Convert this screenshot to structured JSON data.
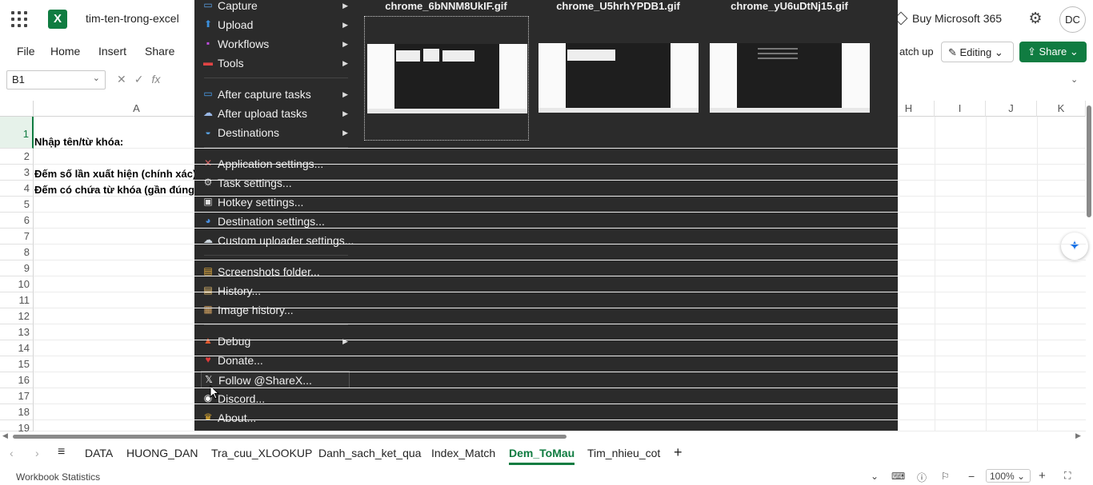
{
  "titlebar": {
    "doc_title": "tim-ten-trong-excel",
    "buy_label": "Buy Microsoft 365",
    "avatar_initials": "DC"
  },
  "ribbon": {
    "tabs": [
      "File",
      "Home",
      "Insert",
      "Share"
    ],
    "catchup_label": "atch up",
    "editing_label": "Editing",
    "share_label": "Share"
  },
  "formula_bar": {
    "name_box": "B1",
    "fx": "fx"
  },
  "grid": {
    "columns": [
      "A",
      "H",
      "I",
      "J",
      "K"
    ],
    "rows": [
      "1",
      "2",
      "3",
      "4",
      "5",
      "6",
      "7",
      "8",
      "9",
      "10",
      "11",
      "12",
      "13",
      "14",
      "15",
      "16",
      "17",
      "18",
      "19"
    ],
    "cells": {
      "A1": "Nhập tên/từ khóa:",
      "A3": "Đếm số lần xuất hiện (chính xác):",
      "A4": "Đếm có chứa từ khóa (gần đúng):"
    }
  },
  "sheet_tabs": [
    "DATA",
    "HUONG_DAN",
    "Tra_cuu_XLOOKUP",
    "Danh_sach_ket_qua",
    "Index_Match",
    "Dem_ToMau",
    "Tim_nhieu_cot"
  ],
  "active_sheet": "Dem_ToMau",
  "status": {
    "left": "Workbook Statistics",
    "zoom": "100%"
  },
  "sharex_menu": {
    "items": [
      {
        "label": "Capture",
        "icon": "capture-icon",
        "submenu": true
      },
      {
        "label": "Upload",
        "icon": "upload-icon",
        "submenu": true
      },
      {
        "label": "Workflows",
        "icon": "workflows-icon",
        "submenu": true
      },
      {
        "label": "Tools",
        "icon": "tools-icon",
        "submenu": true
      },
      {
        "label": "After capture tasks",
        "icon": "after-capture-icon",
        "submenu": true
      },
      {
        "label": "After upload tasks",
        "icon": "after-upload-icon",
        "submenu": true
      },
      {
        "label": "Destinations",
        "icon": "destinations-icon",
        "submenu": true
      },
      {
        "label": "Application settings...",
        "icon": "app-settings-icon",
        "submenu": false
      },
      {
        "label": "Task settings...",
        "icon": "task-settings-icon",
        "submenu": false
      },
      {
        "label": "Hotkey settings...",
        "icon": "hotkey-icon",
        "submenu": false
      },
      {
        "label": "Destination settings...",
        "icon": "destination-settings-icon",
        "submenu": false
      },
      {
        "label": "Custom uploader settings...",
        "icon": "custom-uploader-icon",
        "submenu": false
      },
      {
        "label": "Screenshots folder...",
        "icon": "folder-icon",
        "submenu": false
      },
      {
        "label": "History...",
        "icon": "history-icon",
        "submenu": false
      },
      {
        "label": "Image history...",
        "icon": "image-history-icon",
        "submenu": false
      },
      {
        "label": "Debug",
        "icon": "debug-icon",
        "submenu": true
      },
      {
        "label": "Donate...",
        "icon": "heart-icon",
        "submenu": false
      },
      {
        "label": "Follow @ShareX...",
        "icon": "x-logo-icon",
        "submenu": false
      },
      {
        "label": "Discord...",
        "icon": "discord-icon",
        "submenu": false
      },
      {
        "label": "About...",
        "icon": "crown-icon",
        "submenu": false
      }
    ]
  },
  "thumbnails": [
    {
      "name": "chrome_6bNNM8UkIF.gif"
    },
    {
      "name": "chrome_U5hrhYPDB1.gif"
    },
    {
      "name": "chrome_yU6uDtNj15.gif"
    }
  ],
  "colors": {
    "excel_green": "#107c41",
    "overlay_bg": "#2b2b2b"
  }
}
